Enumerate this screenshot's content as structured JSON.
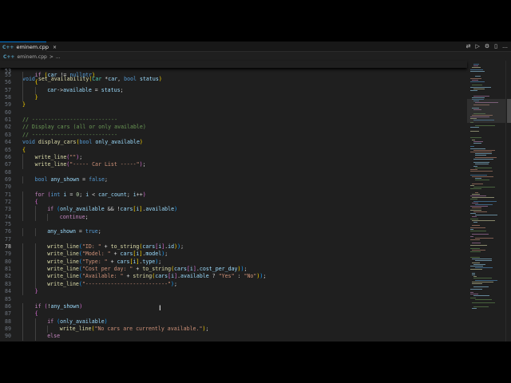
{
  "tab": {
    "icon": "C++",
    "label": "eminem.cpp",
    "close": "×"
  },
  "toolbar": {
    "compare_icon": "⇄",
    "run_icon": "▷",
    "settings_icon": "⚙",
    "split_icon": "▯",
    "more_icon": "…"
  },
  "breadcrumb": {
    "icon": "C++",
    "file": "eminem.cpp",
    "separator": ">",
    "more": "..."
  },
  "sticky_line": {
    "number": "53",
    "text": "void set_availability(Car *car, bool status)"
  },
  "lines": [
    {
      "n": "55",
      "i": 1,
      "tokens": [
        [
          "c",
          "if "
        ],
        [
          "y",
          "("
        ],
        [
          "v",
          "car "
        ],
        [
          "p",
          "!= "
        ],
        [
          "k",
          "nullptr"
        ],
        [
          "y",
          ")"
        ]
      ]
    },
    {
      "n": "56",
      "i": 1,
      "tokens": [
        [
          "y",
          "{"
        ]
      ]
    },
    {
      "n": "57",
      "i": 2,
      "tokens": [
        [
          "v",
          "car"
        ],
        [
          "p",
          "->"
        ],
        [
          "v",
          "available "
        ],
        [
          "p",
          "= "
        ],
        [
          "v",
          "status"
        ],
        [
          "p",
          ";"
        ]
      ]
    },
    {
      "n": "58",
      "i": 1,
      "tokens": [
        [
          "y",
          "}"
        ]
      ]
    },
    {
      "n": "59",
      "i": 0,
      "tokens": [
        [
          "y",
          "}"
        ]
      ]
    },
    {
      "n": "60",
      "i": 0,
      "tokens": []
    },
    {
      "n": "61",
      "i": 0,
      "tokens": [
        [
          "cm",
          "// ---------------------------"
        ]
      ]
    },
    {
      "n": "62",
      "i": 0,
      "tokens": [
        [
          "cm",
          "// Display cars (all or only available)"
        ]
      ]
    },
    {
      "n": "63",
      "i": 0,
      "tokens": [
        [
          "cm",
          "// ---------------------------"
        ]
      ]
    },
    {
      "n": "64",
      "i": 0,
      "tokens": [
        [
          "k",
          "void "
        ],
        [
          "f",
          "display_cars"
        ],
        [
          "y",
          "("
        ],
        [
          "k",
          "bool "
        ],
        [
          "v",
          "only_available"
        ],
        [
          "y",
          ")"
        ]
      ]
    },
    {
      "n": "65",
      "i": 0,
      "tokens": [
        [
          "y",
          "{"
        ]
      ]
    },
    {
      "n": "66",
      "i": 1,
      "tokens": [
        [
          "f",
          "write_line"
        ],
        [
          "m",
          "("
        ],
        [
          "s",
          "\"\""
        ],
        [
          "m",
          ")"
        ],
        [
          "p",
          ";"
        ]
      ]
    },
    {
      "n": "67",
      "i": 1,
      "tokens": [
        [
          "f",
          "write_line"
        ],
        [
          "m",
          "("
        ],
        [
          "s",
          "\"----- Car List -----\""
        ],
        [
          "m",
          ")"
        ],
        [
          "p",
          ";"
        ]
      ]
    },
    {
      "n": "68",
      "i": 0,
      "tokens": []
    },
    {
      "n": "69",
      "i": 1,
      "tokens": [
        [
          "k",
          "bool "
        ],
        [
          "v",
          "any_shown "
        ],
        [
          "p",
          "= "
        ],
        [
          "k",
          "false"
        ],
        [
          "p",
          ";"
        ]
      ]
    },
    {
      "n": "70",
      "i": 0,
      "tokens": []
    },
    {
      "n": "71",
      "i": 1,
      "tokens": [
        [
          "c",
          "for "
        ],
        [
          "m",
          "("
        ],
        [
          "k",
          "int "
        ],
        [
          "v",
          "i "
        ],
        [
          "p",
          "= "
        ],
        [
          "n",
          "0"
        ],
        [
          "p",
          "; "
        ],
        [
          "v",
          "i "
        ],
        [
          "p",
          "< "
        ],
        [
          "v",
          "car_count"
        ],
        [
          "p",
          "; "
        ],
        [
          "v",
          "i"
        ],
        [
          "p",
          "++"
        ],
        [
          "m",
          ")"
        ]
      ]
    },
    {
      "n": "72",
      "i": 1,
      "tokens": [
        [
          "m",
          "{"
        ]
      ]
    },
    {
      "n": "73",
      "i": 2,
      "tokens": [
        [
          "c",
          "if "
        ],
        [
          "b",
          "("
        ],
        [
          "v",
          "only_available "
        ],
        [
          "p",
          "&& !"
        ],
        [
          "v",
          "cars"
        ],
        [
          "y",
          "["
        ],
        [
          "v",
          "i"
        ],
        [
          "y",
          "]"
        ],
        [
          "p",
          "."
        ],
        [
          "v",
          "available"
        ],
        [
          "b",
          ")"
        ]
      ]
    },
    {
      "n": "74",
      "i": 3,
      "tokens": [
        [
          "c",
          "continue"
        ],
        [
          "p",
          ";"
        ]
      ]
    },
    {
      "n": "75",
      "i": 0,
      "tokens": []
    },
    {
      "n": "76",
      "i": 2,
      "tokens": [
        [
          "v",
          "any_shown "
        ],
        [
          "p",
          "= "
        ],
        [
          "k",
          "true"
        ],
        [
          "p",
          ";"
        ]
      ]
    },
    {
      "n": "77",
      "i": 0,
      "tokens": []
    },
    {
      "n": "78",
      "i": 2,
      "tokens": [
        [
          "f",
          "write_line"
        ],
        [
          "b",
          "("
        ],
        [
          "s",
          "\"ID: \" "
        ],
        [
          "p",
          "+ "
        ],
        [
          "f",
          "to_string"
        ],
        [
          "y",
          "("
        ],
        [
          "v",
          "cars"
        ],
        [
          "m",
          "["
        ],
        [
          "v",
          "i"
        ],
        [
          "m",
          "]"
        ],
        [
          "p",
          "."
        ],
        [
          "v",
          "id"
        ],
        [
          "y",
          ")"
        ],
        [
          "b",
          ")"
        ],
        [
          "p",
          ";"
        ]
      ]
    },
    {
      "n": "79",
      "i": 2,
      "tokens": [
        [
          "f",
          "write_line"
        ],
        [
          "b",
          "("
        ],
        [
          "s",
          "\"Model: \" "
        ],
        [
          "p",
          "+ "
        ],
        [
          "v",
          "cars"
        ],
        [
          "y",
          "["
        ],
        [
          "v",
          "i"
        ],
        [
          "y",
          "]"
        ],
        [
          "p",
          "."
        ],
        [
          "v",
          "model"
        ],
        [
          "b",
          ")"
        ],
        [
          "p",
          ";"
        ]
      ]
    },
    {
      "n": "80",
      "i": 2,
      "tokens": [
        [
          "f",
          "write_line"
        ],
        [
          "b",
          "("
        ],
        [
          "s",
          "\"Type: \" "
        ],
        [
          "p",
          "+ "
        ],
        [
          "v",
          "cars"
        ],
        [
          "y",
          "["
        ],
        [
          "v",
          "i"
        ],
        [
          "y",
          "]"
        ],
        [
          "p",
          "."
        ],
        [
          "v",
          "type"
        ],
        [
          "b",
          ")"
        ],
        [
          "p",
          ";"
        ]
      ]
    },
    {
      "n": "81",
      "i": 2,
      "tokens": [
        [
          "f",
          "write_line"
        ],
        [
          "b",
          "("
        ],
        [
          "s",
          "\"Cost per day: \" "
        ],
        [
          "p",
          "+ "
        ],
        [
          "f",
          "to_string"
        ],
        [
          "y",
          "("
        ],
        [
          "v",
          "cars"
        ],
        [
          "m",
          "["
        ],
        [
          "v",
          "i"
        ],
        [
          "m",
          "]"
        ],
        [
          "p",
          "."
        ],
        [
          "v",
          "cost_per_day"
        ],
        [
          "y",
          ")"
        ],
        [
          "b",
          ")"
        ],
        [
          "p",
          ";"
        ]
      ]
    },
    {
      "n": "82",
      "i": 2,
      "tokens": [
        [
          "f",
          "write_line"
        ],
        [
          "b",
          "("
        ],
        [
          "s",
          "\"Available: \" "
        ],
        [
          "p",
          "+ "
        ],
        [
          "f",
          "string"
        ],
        [
          "y",
          "("
        ],
        [
          "v",
          "cars"
        ],
        [
          "m",
          "["
        ],
        [
          "v",
          "i"
        ],
        [
          "m",
          "]"
        ],
        [
          "p",
          "."
        ],
        [
          "v",
          "available "
        ],
        [
          "p",
          "? "
        ],
        [
          "s",
          "\"Yes\" "
        ],
        [
          "p",
          ": "
        ],
        [
          "s",
          "\"No\""
        ],
        [
          "y",
          ")"
        ],
        [
          "b",
          ")"
        ],
        [
          "p",
          ";"
        ]
      ]
    },
    {
      "n": "83",
      "i": 2,
      "tokens": [
        [
          "f",
          "write_line"
        ],
        [
          "b",
          "("
        ],
        [
          "s",
          "\"--------------------------\""
        ],
        [
          "b",
          ")"
        ],
        [
          "p",
          ";"
        ]
      ]
    },
    {
      "n": "84",
      "i": 1,
      "tokens": [
        [
          "m",
          "}"
        ]
      ]
    },
    {
      "n": "85",
      "i": 0,
      "tokens": []
    },
    {
      "n": "86",
      "i": 1,
      "tokens": [
        [
          "c",
          "if "
        ],
        [
          "m",
          "("
        ],
        [
          "p",
          "!"
        ],
        [
          "v",
          "any_shown"
        ],
        [
          "m",
          ")"
        ]
      ]
    },
    {
      "n": "87",
      "i": 1,
      "tokens": [
        [
          "m",
          "{"
        ]
      ]
    },
    {
      "n": "88",
      "i": 2,
      "tokens": [
        [
          "c",
          "if "
        ],
        [
          "b",
          "("
        ],
        [
          "v",
          "only_available"
        ],
        [
          "b",
          ")"
        ]
      ]
    },
    {
      "n": "89",
      "i": 3,
      "tokens": [
        [
          "f",
          "write_line"
        ],
        [
          "y",
          "("
        ],
        [
          "s",
          "\"No cars are currently available.\""
        ],
        [
          "y",
          ")"
        ],
        [
          "p",
          ";"
        ]
      ]
    },
    {
      "n": "90",
      "i": 2,
      "tokens": [
        [
          "c",
          "else"
        ]
      ]
    }
  ]
}
